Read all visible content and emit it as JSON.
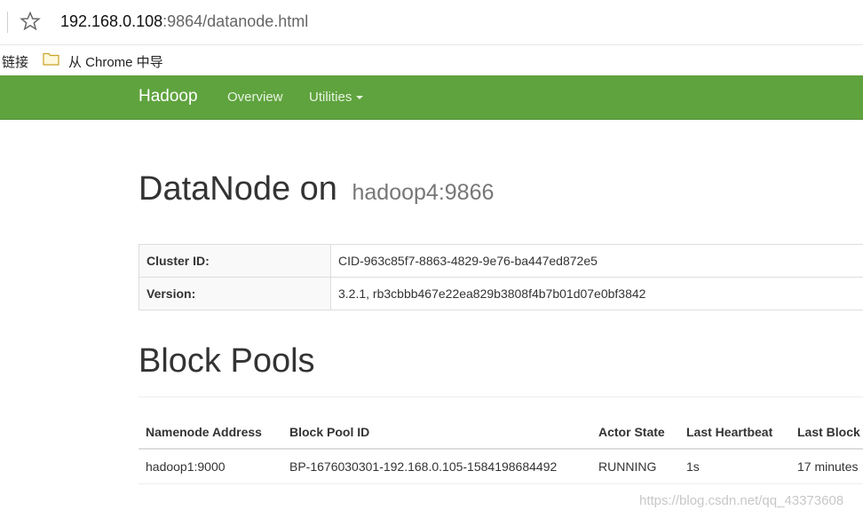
{
  "browser": {
    "url_host": "192.168.0.108",
    "url_rest": ":9864/datanode.html",
    "bookmarks_label": "链接",
    "bookmark_item": "从 Chrome 中导"
  },
  "navbar": {
    "brand": "Hadoop",
    "overview": "Overview",
    "utilities": "Utilities"
  },
  "page": {
    "title": "DataNode on",
    "host": "hadoop4:9866"
  },
  "info": [
    {
      "key": "Cluster ID:",
      "value": "CID-963c85f7-8863-4829-9e76-ba447ed872e5"
    },
    {
      "key": "Version:",
      "value": "3.2.1, rb3cbbb467e22ea829b3808f4b7b01d07e0bf3842"
    }
  ],
  "block_pools": {
    "title": "Block Pools",
    "headers": [
      "Namenode Address",
      "Block Pool ID",
      "Actor State",
      "Last Heartbeat",
      "Last Block Report"
    ],
    "rows": [
      [
        "hadoop1:9000",
        "BP-1676030301-192.168.0.105-1584198684492",
        "RUNNING",
        "1s",
        "17 minutes"
      ]
    ]
  },
  "watermark": "https://blog.csdn.net/qq_43373608",
  "colors": {
    "navbar": "#5fa33e",
    "nav_text": "#e8f3e2"
  }
}
